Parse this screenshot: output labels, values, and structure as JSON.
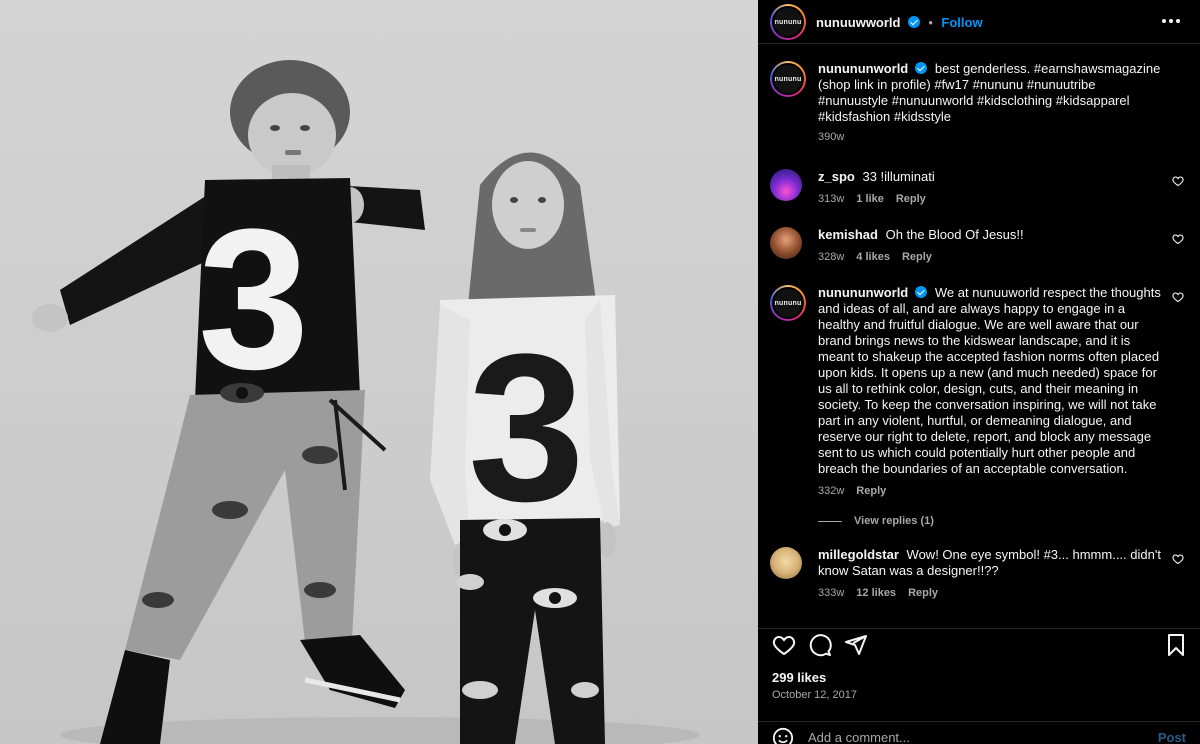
{
  "post": {
    "author": "nunuuwworld",
    "author_avatar_text": "nununu",
    "follow_label": "Follow",
    "separator": "•"
  },
  "caption": {
    "username": "nunununworld",
    "text": "best genderless. #earnshawsmagazine (shop link in profile) #fw17 #nununu #nunuutribe #nunuustyle #nunuunworld #kidsclothing #kidsapparel #kidsfashion #kidsstyle",
    "age": "390w"
  },
  "comments": [
    {
      "username": "z_spo",
      "text": "33 !illuminati",
      "age": "313w",
      "likes": "1 like",
      "reply": "Reply"
    },
    {
      "username": "kemishad",
      "text": "Oh the Blood Of Jesus!!",
      "age": "328w",
      "likes": "4 likes",
      "reply": "Reply"
    },
    {
      "username": "nunununworld",
      "text": "We at nunuuworld respect the thoughts and ideas of all, and are always happy to engage in a healthy and fruitful dialogue. We are well aware that our brand brings news to the kidswear landscape, and it is meant to shakeup the accepted fashion norms often placed upon kids. It opens up a new (and much needed) space for us all to rethink color, design, cuts, and their meaning in society. To keep the conversation inspiring, we will not take part in any violent, hurtful, or demeaning dialogue, and reserve our right to delete, report, and block any message sent to us which could potentially hurt other people and breach the boundaries of an acceptable conversation.",
      "age": "332w",
      "reply": "Reply",
      "view_replies": "View replies (1)"
    },
    {
      "username": "millegoldstar",
      "text": "Wow! One eye symbol! #3... hmmm.... didn't know Satan was a designer!!??",
      "age": "333w",
      "likes": "12 likes",
      "reply": "Reply"
    }
  ],
  "footer": {
    "likes": "299 likes",
    "date": "October 12, 2017",
    "comment_placeholder": "Add a comment...",
    "post_label": "Post"
  },
  "photo": {
    "shirt_number": "3"
  },
  "colors": {
    "accent": "#0095f6",
    "background": "#000000",
    "muted": "#a8a8a8"
  }
}
